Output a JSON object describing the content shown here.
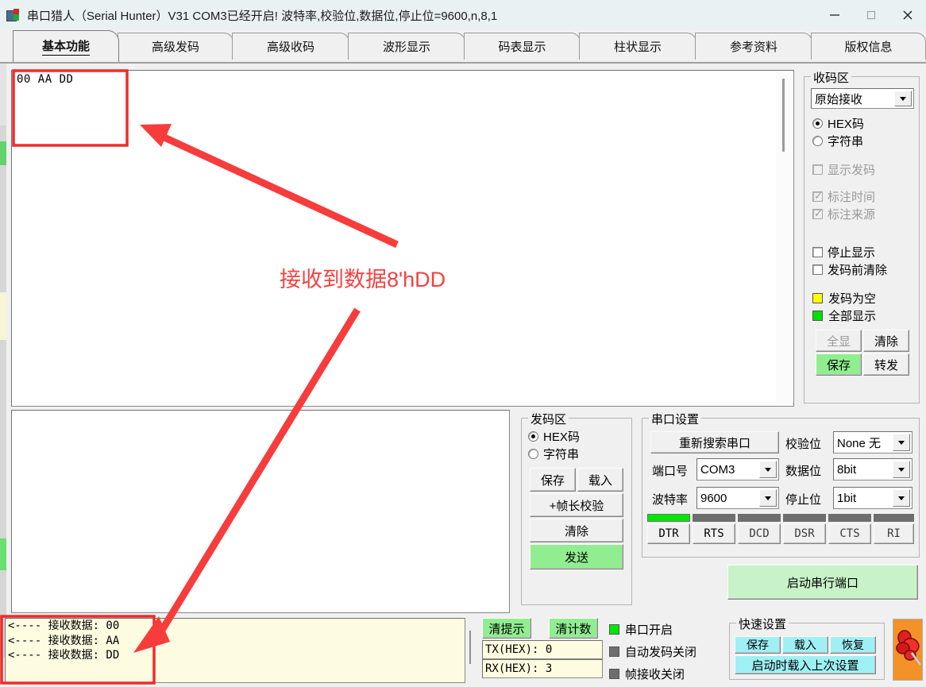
{
  "window": {
    "title": "串口猎人（Serial Hunter）V31    COM3已经开启!  波特率,校验位,数据位,停止位=9600,n,8,1",
    "app_icon": "serial-hunter-icon",
    "minimize_label": "—",
    "maximize_label": "□",
    "close_label": "✕"
  },
  "tabs": [
    {
      "label": "基本功能",
      "selected": true
    },
    {
      "label": "高级发码",
      "selected": false
    },
    {
      "label": "高级收码",
      "selected": false
    },
    {
      "label": "波形显示",
      "selected": false
    },
    {
      "label": "码表显示",
      "selected": false
    },
    {
      "label": "柱状显示",
      "selected": false
    },
    {
      "label": "参考资料",
      "selected": false
    },
    {
      "label": "版权信息",
      "selected": false
    }
  ],
  "receive_area": {
    "text": "00 AA DD",
    "scrollbar": "vertical-scrollbar"
  },
  "send_area": {
    "text": "",
    "placeholder": ""
  },
  "recv_panel": {
    "caption": "收码区",
    "mode_combo": {
      "value": "原始接收"
    },
    "radios": [
      {
        "label": "HEX码",
        "checked": true
      },
      {
        "label": "字符串",
        "checked": false
      }
    ],
    "checkboxes": [
      {
        "label": "显示发码",
        "checked": false,
        "disabled": true
      },
      {
        "label": "标注时间",
        "checked": true,
        "disabled": true
      },
      {
        "label": "标注来源",
        "checked": true,
        "disabled": true
      },
      {
        "label": "停止显示",
        "checked": false,
        "disabled": false
      },
      {
        "label": "发码前清除",
        "checked": false,
        "disabled": false
      }
    ],
    "leds": [
      {
        "label": "发码为空",
        "color": "#ffff00"
      },
      {
        "label": "全部显示",
        "color": "#00e000"
      }
    ],
    "buttons": [
      {
        "label": "全显",
        "style": "disabled"
      },
      {
        "label": "清除",
        "style": "normal"
      },
      {
        "label": "保存",
        "style": "green"
      },
      {
        "label": "转发",
        "style": "normal"
      }
    ]
  },
  "send_panel": {
    "caption": "发码区",
    "radios": [
      {
        "label": "HEX码",
        "checked": true
      },
      {
        "label": "字符串",
        "checked": false
      }
    ],
    "buttons": [
      {
        "label": "保存",
        "style": "normal"
      },
      {
        "label": "载入",
        "style": "normal"
      },
      {
        "label": "+帧长校验",
        "style": "normal"
      },
      {
        "label": "清除",
        "style": "normal"
      },
      {
        "label": "发送",
        "style": "green"
      }
    ]
  },
  "serial_panel": {
    "caption": "串口设置",
    "rescan_button": "重新搜索串口",
    "fields": [
      {
        "label": "端口号",
        "value": "COM3"
      },
      {
        "label": "波特率",
        "value": "9600"
      },
      {
        "label": "校验位",
        "value": "None 无"
      },
      {
        "label": "数据位",
        "value": "8bit"
      },
      {
        "label": "停止位",
        "value": "1bit"
      }
    ],
    "signals": [
      {
        "label": "DTR",
        "active": true
      },
      {
        "label": "RTS",
        "active": false
      },
      {
        "label": "DCD",
        "active": false
      },
      {
        "label": "DSR",
        "active": false
      },
      {
        "label": "CTS",
        "active": false
      },
      {
        "label": "RI",
        "active": false
      }
    ],
    "start_button": "启动串行端口"
  },
  "status_bar": {
    "log_lines": [
      "<---- 接收数据: 00",
      "<---- 接收数据: AA",
      "<---- 接收数据: DD"
    ],
    "buttons": [
      {
        "label": "清提示",
        "style": "green"
      },
      {
        "label": "清计数",
        "style": "green"
      }
    ],
    "counters": [
      {
        "label": "TX(HEX): 0"
      },
      {
        "label": "RX(HEX): 3"
      }
    ],
    "indicators": [
      {
        "label": "串口开启",
        "color": "#00e000"
      },
      {
        "label": "自动发码关闭",
        "color": "#6e6e6e"
      },
      {
        "label": "帧接收关闭",
        "color": "#6e6e6e"
      }
    ],
    "quick_settings": {
      "caption": "快速设置",
      "buttons": [
        "保存",
        "载入",
        "恢复"
      ],
      "wide_button": "启动时载入上次设置"
    },
    "pin_icon": "pushpin-icon"
  },
  "annotations": {
    "highlight_color": "#f02b2b",
    "note_text": "接收到数据8'hDD",
    "note_color": "#f5413f",
    "boxes": [
      {
        "name": "rx-data-highlight"
      },
      {
        "name": "log-highlight"
      }
    ],
    "arrows": [
      {
        "name": "arrow-to-rx-data"
      },
      {
        "name": "arrow-to-log"
      }
    ]
  }
}
